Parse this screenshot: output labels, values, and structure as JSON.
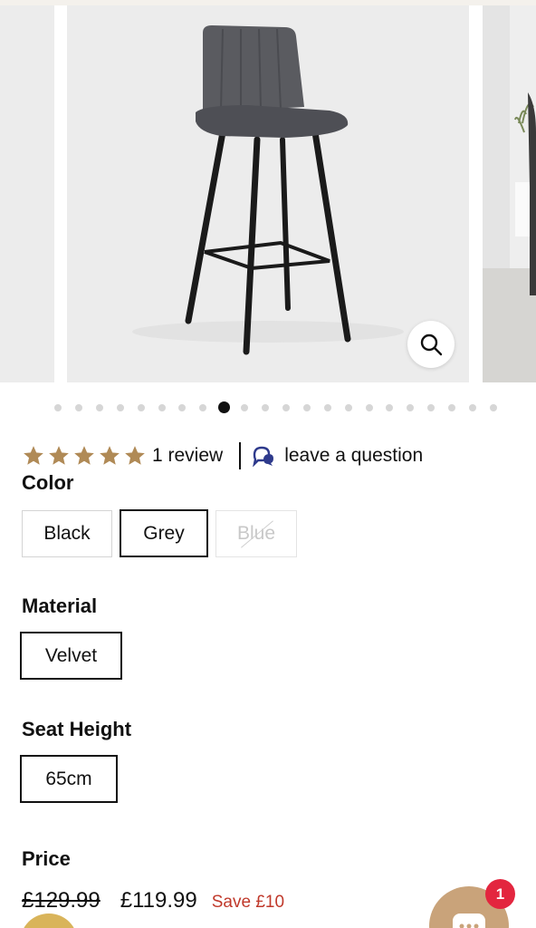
{
  "gallery": {
    "total_images": 22,
    "active_index": 8,
    "zoom_icon": "magnifier-icon"
  },
  "rating": {
    "stars": 5,
    "star_color": "#b08a56",
    "review_text": "1 review",
    "question_text": "leave a question",
    "question_icon": "chat-bubbles-icon"
  },
  "color": {
    "label": "Color",
    "options": [
      "Black",
      "Grey",
      "Blue"
    ],
    "selected": "Grey",
    "unavailable": "Blue"
  },
  "material": {
    "label": "Material",
    "options": [
      "Velvet"
    ],
    "selected": "Velvet"
  },
  "seat_height": {
    "label": "Seat Height",
    "options": [
      "65cm"
    ],
    "selected": "65cm"
  },
  "price": {
    "label": "Price",
    "original": "£129.99",
    "current": "£119.99",
    "save": "Save £10",
    "save_color": "#c0392b"
  },
  "chat": {
    "badge_count": "1",
    "icon": "chat-icon"
  }
}
